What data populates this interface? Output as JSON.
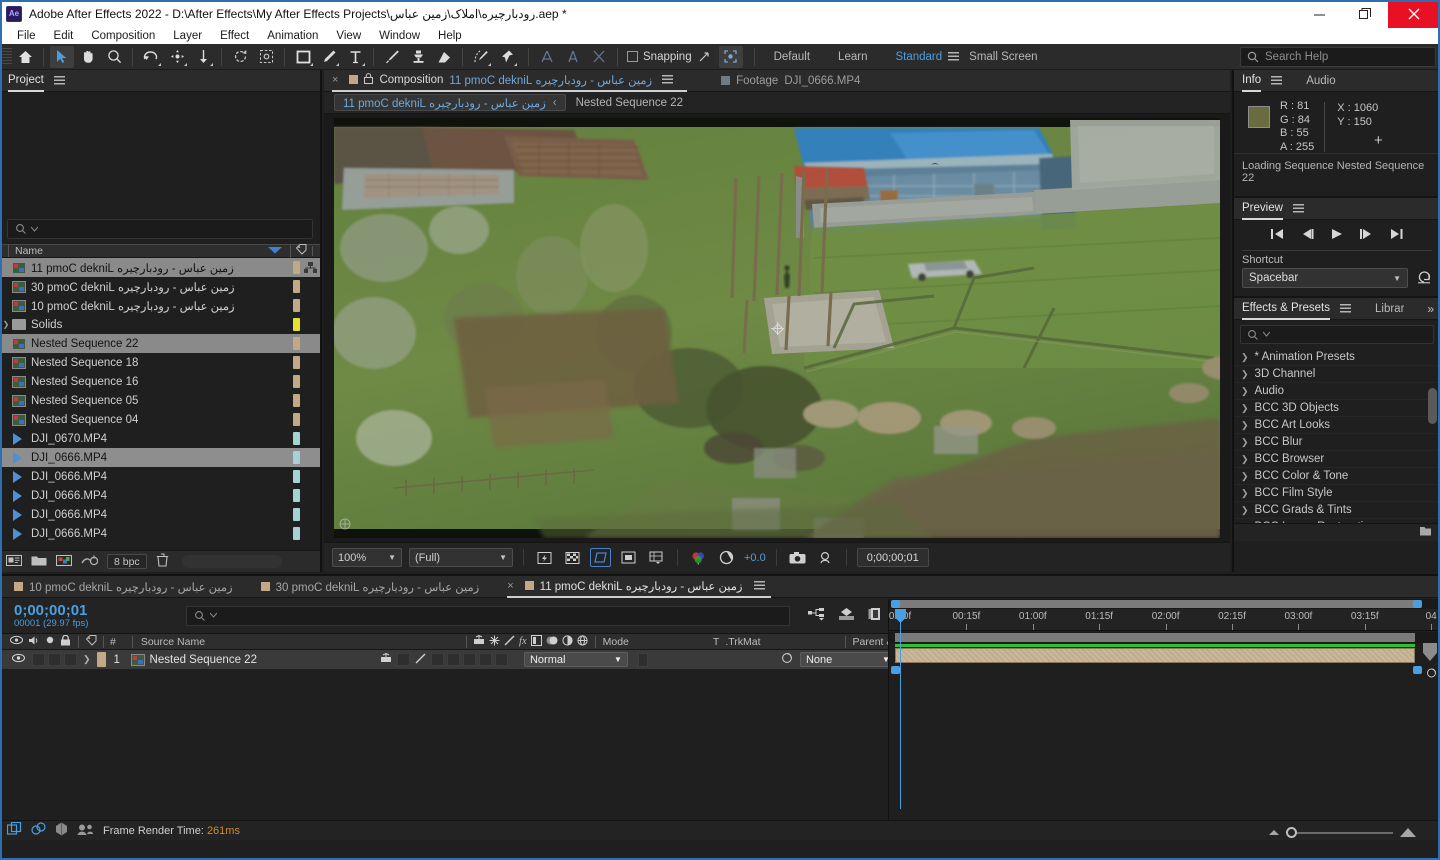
{
  "window": {
    "app_title": "Adobe After Effects 2022 - D:\\After Effects\\My After Effects Projects\\رودبارچیره\\املاک\\زمین عباس.aep *",
    "minimize": "minimize-icon",
    "maximize": "maximize-icon",
    "close": "close-icon"
  },
  "menubar": {
    "items": [
      "File",
      "Edit",
      "Composition",
      "Layer",
      "Effect",
      "Animation",
      "View",
      "Window",
      "Help"
    ]
  },
  "toolbar": {
    "tools": [
      "home-icon",
      "selection-icon",
      "hand-icon",
      "zoom-icon",
      "rotation-icon",
      "unified-camera-icon",
      "pan-behind-icon",
      "rotate-icon",
      "mask-free-transform-icon",
      "rectangle-icon",
      "pen-icon",
      "type-icon",
      "brush-icon",
      "clone-stamp-icon",
      "eraser-icon",
      "roto-brush-icon",
      "puppet-pin-icon"
    ],
    "snapping_label": "Snapping",
    "workspaces": [
      "Default",
      "Learn",
      "Standard",
      "Small Screen"
    ],
    "active_workspace": "Standard",
    "overflow": "»"
  },
  "search_help": {
    "placeholder": "Search Help",
    "icon": "search-icon"
  },
  "project_panel": {
    "tab_label": "Project",
    "search_placeholder": "",
    "column_header": "Name",
    "items": [
      {
        "label": "زمین عباس - رودبارچیره Linked Comp 11",
        "type": "composition",
        "swatch": "#c3a887",
        "selected": true,
        "rtl": true,
        "has_shortcut": true
      },
      {
        "label": "زمین عباس - رودبارچیره Linked Comp 03",
        "type": "composition",
        "swatch": "#c3a887",
        "selected": false,
        "rtl": true,
        "has_shortcut": false
      },
      {
        "label": "زمین عباس - رودبارچیره Linked Comp 01",
        "type": "composition",
        "swatch": "#c3a887",
        "selected": false,
        "rtl": true,
        "has_shortcut": false
      },
      {
        "label": "Solids",
        "type": "folder",
        "swatch": "#e6e02f",
        "selected": false,
        "rtl": false,
        "has_shortcut": false
      },
      {
        "label": "Nested Sequence 22",
        "type": "composition",
        "swatch": "#c3a887",
        "selected": true,
        "rtl": false,
        "has_shortcut": false
      },
      {
        "label": "Nested Sequence 18",
        "type": "composition",
        "swatch": "#c3a887",
        "selected": false,
        "rtl": false,
        "has_shortcut": false
      },
      {
        "label": "Nested Sequence 16",
        "type": "composition",
        "swatch": "#c3a887",
        "selected": false,
        "rtl": false,
        "has_shortcut": false
      },
      {
        "label": "Nested Sequence 05",
        "type": "composition",
        "swatch": "#c3a887",
        "selected": false,
        "rtl": false,
        "has_shortcut": false
      },
      {
        "label": "Nested Sequence 04",
        "type": "composition",
        "swatch": "#c3a887",
        "selected": false,
        "rtl": false,
        "has_shortcut": false
      },
      {
        "label": "DJI_0670.MP4",
        "type": "footage",
        "swatch": "#a5d3d4",
        "selected": false,
        "rtl": false,
        "has_shortcut": false
      },
      {
        "label": "DJI_0666.MP4",
        "type": "footage",
        "swatch": "#a5d3d4",
        "selected": true,
        "rtl": false,
        "has_shortcut": false
      },
      {
        "label": "DJI_0666.MP4",
        "type": "footage",
        "swatch": "#a5d3d4",
        "selected": false,
        "rtl": false,
        "has_shortcut": false
      },
      {
        "label": "DJI_0666.MP4",
        "type": "footage",
        "swatch": "#a5d3d4",
        "selected": false,
        "rtl": false,
        "has_shortcut": false
      },
      {
        "label": "DJI_0666.MP4",
        "type": "footage",
        "swatch": "#a5d3d4",
        "selected": false,
        "rtl": false,
        "has_shortcut": false
      },
      {
        "label": "DJI_0666.MP4",
        "type": "footage",
        "swatch": "#a5d3d4",
        "selected": false,
        "rtl": false,
        "has_shortcut": false
      }
    ],
    "footer": {
      "bit_depth": "8 bpc",
      "icons": [
        "interpret-footage-icon",
        "new-folder-icon",
        "new-composition-icon",
        "project-settings-icon",
        "delete-icon"
      ]
    }
  },
  "viewer": {
    "tabs": [
      {
        "prefix": "Composition",
        "label": "زمین عباس - رودبارچیره Linked Comp 11",
        "selected": true,
        "closable": true,
        "locked": true
      },
      {
        "prefix": "Footage",
        "label": "DJI_0666.MP4",
        "selected": false,
        "closable": false,
        "locked": false
      }
    ],
    "breadcrumb": {
      "current": "زمین عباس - رودبارچیره Linked Comp 11",
      "child": "Nested Sequence 22",
      "separator": "‹"
    },
    "bottom_bar": {
      "zoom": "100%",
      "resolution": "(Full)",
      "exposure": "+0.0",
      "timecode": "0;00;00;01",
      "buttons": [
        "fast-previews-icon",
        "transparency-grid-icon",
        "region-of-interest-icon",
        "mask-shape-icon",
        "title-action-safe-icon",
        "channel-rgb-icon",
        "exposure-icon",
        "take-snapshot-icon",
        "show-snapshot-icon"
      ]
    }
  },
  "info_panel": {
    "tabs": [
      "Info",
      "Audio"
    ],
    "active_tab": "Info",
    "color": {
      "r": "R : 81",
      "g": "G : 84",
      "b": "B : 55",
      "a": "A : 255",
      "swatch_hex": "#6a6b3e"
    },
    "position": {
      "x": "X : 1060",
      "y": "Y : 150"
    },
    "status": "Loading Sequence Nested Sequence 22"
  },
  "preview_panel": {
    "tab_label": "Preview",
    "transport": [
      "first-frame-icon",
      "previous-frame-icon",
      "play-icon",
      "next-frame-icon",
      "last-frame-icon"
    ],
    "shortcut_label": "Shortcut",
    "shortcut_value": "Spacebar",
    "reset_icon": "reset-icon"
  },
  "effects_panel": {
    "tabs": [
      "Effects & Presets",
      "Librar"
    ],
    "active_tab": "Effects & Presets",
    "search_placeholder": "",
    "categories": [
      "* Animation Presets",
      "3D Channel",
      "Audio",
      "BCC 3D Objects",
      "BCC Art Looks",
      "BCC Blur",
      "BCC Browser",
      "BCC Color & Tone",
      "BCC Film Style",
      "BCC Grads & Tints",
      "BCC Image Restoration"
    ]
  },
  "timeline": {
    "tabs": [
      {
        "label": "زمین عباس - رودبارچیره Linked Comp 01",
        "selected": false,
        "closable": false
      },
      {
        "label": "زمین عباس - رودبارچیره Linked Comp 03",
        "selected": false,
        "closable": false
      },
      {
        "label": "زمین عباس - رودبارچیره Linked Comp 11",
        "selected": true,
        "closable": true
      }
    ],
    "current_time": "0;00;00;01",
    "frame_info": "00001 (29.97 fps)",
    "search_placeholder": "",
    "toolbar_icons": [
      "composition-mini-flowchart-icon",
      "draft-3d-icon",
      "hide-shy-layers-icon",
      "motion-blur-icon",
      "graph-editor-icon"
    ],
    "columns": {
      "source_name": "Source Name",
      "mode": "Mode",
      "t": "T",
      "trkmat": "TrkMat",
      "parent_link": "Parent & Link"
    },
    "layers": [
      {
        "index": "1",
        "name": "Nested Sequence 22",
        "mode": "Normal",
        "trkmat": "",
        "parent": "None",
        "swatch": "#c3a887"
      }
    ],
    "ruler": {
      "labels": [
        "0:00f",
        "00:15f",
        "01:00f",
        "01:15f",
        "02:00f",
        "02:15f",
        "03:00f",
        "03:15f",
        "04"
      ]
    },
    "status": {
      "label": "Frame Render Time:",
      "value": "261ms",
      "icons": [
        "render-queue-icon",
        "composition-flowchart-icon",
        "3d-renderer-icon",
        "team-projects-icon"
      ]
    }
  }
}
